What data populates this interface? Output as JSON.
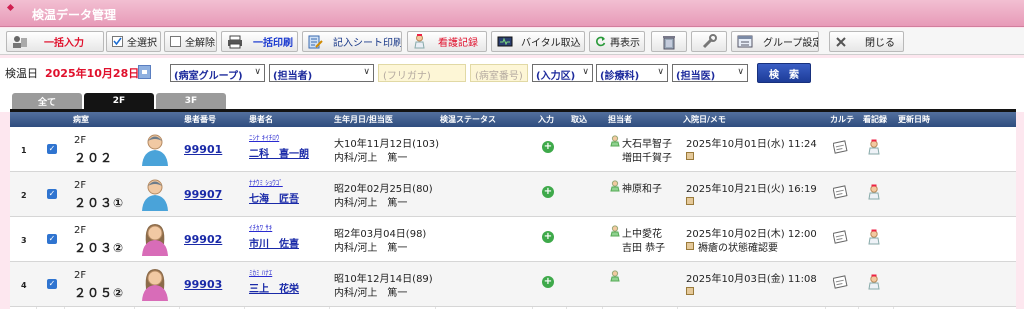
{
  "app": {
    "title": "検温データ管理"
  },
  "toolbar": {
    "bulk_input": "一括入力",
    "select_all": "全選択",
    "deselect_all": "全解除",
    "bulk_print": "一括印刷",
    "entry_sheet_print": "記入シート印刷",
    "nursing_record": "看護記録",
    "vital_import": "バイタル取込",
    "refresh": "再表示",
    "group_settings": "グループ設定",
    "close": "閉じる"
  },
  "filters": {
    "date_label": "検温日",
    "date_value": "2025年10月28日",
    "ward_group": "(病室グループ)",
    "staff": "(担当者)",
    "furigana_placeholder": "(フリガナ)",
    "room_placeholder": "(病室番号)",
    "admission": "(入力区)",
    "department": "(診療科)",
    "doctor": "(担当医)",
    "search_button": "検　索"
  },
  "tabs": [
    "全て",
    "2F",
    "3F"
  ],
  "active_tab": 1,
  "table": {
    "headers": {
      "room": "病室",
      "patient_no": "患者番号",
      "name": "患者名",
      "birth_doctor": "生年月日/担当医",
      "status": "検温ステータス",
      "input": "入力",
      "import": "取込",
      "staff": "担当者",
      "admit_memo": "入院日/メモ",
      "chart": "カルテ",
      "nursing": "看記録",
      "updated": "更新日時"
    },
    "rows": [
      {
        "num": "1",
        "floor": "2F",
        "room": "２０２",
        "gender": "male",
        "patient_no": "99901",
        "kana": "ﾆｼﾅ ｷｲﾁﾛｳ",
        "name": "二科　喜一朗",
        "birth": "大10年11月12日(103)",
        "doctor": "内科/河上　篤一",
        "staff1": "大石早智子",
        "staff2": "増田千賀子",
        "admit": "2025年10月01日(水) 11:24",
        "memo": ""
      },
      {
        "num": "2",
        "floor": "2F",
        "room": "２０３①",
        "gender": "male",
        "patient_no": "99907",
        "kana": "ﾅﾅｳﾐ ｼｮｳｺﾞ",
        "name": "七海　匠吾",
        "birth": "昭20年02月25日(80)",
        "doctor": "内科/河上　篤一",
        "staff1": "神原和子",
        "staff2": "",
        "admit": "2025年10月21日(火) 16:19",
        "memo": ""
      },
      {
        "num": "3",
        "floor": "2F",
        "room": "２０３②",
        "gender": "female",
        "patient_no": "99902",
        "kana": "ｲﾁｶﾜ ｻｷ",
        "name": "市川　佐喜",
        "birth": "昭2年03月04日(98)",
        "doctor": "内科/河上　篤一",
        "staff1": "上中愛花",
        "staff2": "吉田 恭子",
        "admit": "2025年10月02日(木) 12:00",
        "memo": "褥瘡の状態確認要"
      },
      {
        "num": "4",
        "floor": "2F",
        "room": "２０５②",
        "gender": "female",
        "patient_no": "99903",
        "kana": "ﾐｶﾐ ﾊﾅｴ",
        "name": "三上　花栄",
        "birth": "昭10年12月14日(89)",
        "doctor": "内科/河上　篤一",
        "staff1": "",
        "staff2": "",
        "admit": "2025年10月03日(金) 11:08",
        "memo": ""
      }
    ]
  }
}
